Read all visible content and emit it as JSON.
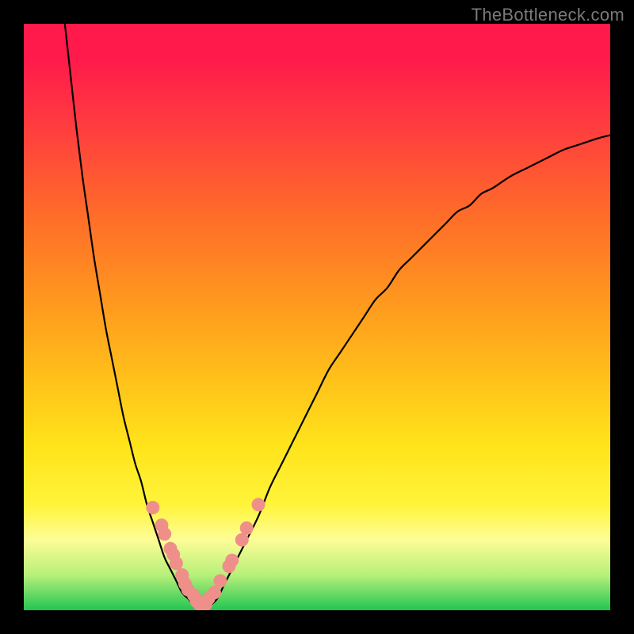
{
  "watermark": "TheBottleneck.com",
  "colors": {
    "curve_stroke": "#000000",
    "dot_fill": "#ef8f8a",
    "dot_stroke": "#d87470",
    "bg_black": "#000000"
  },
  "chart_data": {
    "type": "line",
    "title": "",
    "xlabel": "",
    "ylabel": "",
    "xlim": [
      0,
      100
    ],
    "ylim": [
      0,
      100
    ],
    "curve": {
      "x": [
        7,
        8,
        9,
        10,
        11,
        12,
        13,
        14,
        15,
        16,
        17,
        18,
        19,
        20,
        21,
        22,
        23,
        24,
        25,
        26,
        27,
        28,
        29,
        30,
        31,
        32,
        33,
        34,
        35,
        36,
        38,
        40,
        42,
        44,
        46,
        48,
        50,
        52,
        54,
        56,
        58,
        60,
        62,
        64,
        66,
        68,
        70,
        72,
        74,
        76,
        78,
        80,
        83,
        86,
        89,
        92,
        95,
        98,
        100
      ],
      "y": [
        100,
        91,
        82,
        74,
        67,
        60,
        54,
        48,
        43,
        38,
        33,
        29,
        25,
        22,
        18,
        15,
        12,
        9,
        7,
        5,
        3,
        2,
        1,
        0.5,
        0.5,
        1,
        2,
        4,
        6,
        8,
        12,
        16,
        21,
        25,
        29,
        33,
        37,
        41,
        44,
        47,
        50,
        53,
        55,
        58,
        60,
        62,
        64,
        66,
        68,
        69,
        71,
        72,
        74,
        75.5,
        77,
        78.5,
        79.5,
        80.5,
        81
      ]
    },
    "series": [
      {
        "name": "dots",
        "type": "scatter",
        "x": [
          22,
          23.5,
          24,
          25,
          25.5,
          26,
          27,
          27.5,
          28,
          29,
          29.5,
          30,
          31,
          31.5,
          32.5,
          33.5,
          35,
          35.5,
          37.2,
          38,
          40
        ],
        "y": [
          17.5,
          14.5,
          13,
          10.5,
          9.5,
          8,
          6,
          4.5,
          3.5,
          2.5,
          1.5,
          1,
          1,
          2,
          3,
          5,
          7.5,
          8.5,
          12,
          14,
          18
        ]
      }
    ]
  }
}
